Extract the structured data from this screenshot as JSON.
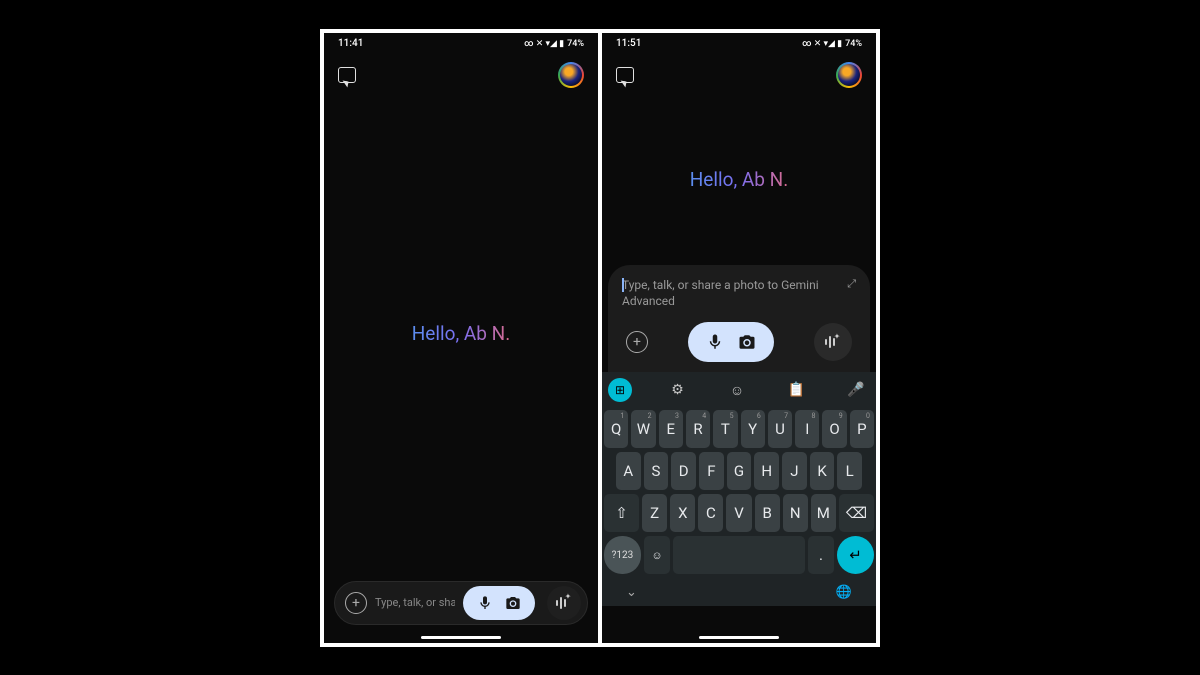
{
  "phone1": {
    "status": {
      "time": "11:41",
      "battery": "74%",
      "icons": "∞ ✕ ▾◢ ▮"
    },
    "top": {
      "chat_icon": "chat-icon",
      "avatar": "profile-avatar"
    },
    "greeting": "Hello, Ab N.",
    "input": {
      "plus": "+",
      "placeholder": "Type, talk, or share...",
      "mic": "mic-icon",
      "camera": "camera-icon",
      "live": "live-audio-icon"
    }
  },
  "phone2": {
    "status": {
      "time": "11:51",
      "battery": "74%",
      "icons": "∞ ✕ ▾◢ ▮"
    },
    "top": {
      "chat_icon": "chat-icon",
      "avatar": "profile-avatar"
    },
    "greeting": "Hello, Ab N.",
    "input": {
      "placeholder": "Type, talk, or share a photo to Gemini Advanced",
      "expand": "⤢",
      "plus": "+",
      "mic": "mic-icon",
      "camera": "camera-icon",
      "live": "live-audio-icon"
    },
    "keyboard": {
      "toolbar": {
        "grid": "⊞",
        "gear": "⚙",
        "emoji": "☺",
        "clipboard": "📋",
        "mic": "🎤"
      },
      "row1": [
        {
          "k": "Q",
          "h": "1"
        },
        {
          "k": "W",
          "h": "2"
        },
        {
          "k": "E",
          "h": "3"
        },
        {
          "k": "R",
          "h": "4"
        },
        {
          "k": "T",
          "h": "5"
        },
        {
          "k": "Y",
          "h": "6"
        },
        {
          "k": "U",
          "h": "7"
        },
        {
          "k": "I",
          "h": "8"
        },
        {
          "k": "O",
          "h": "9"
        },
        {
          "k": "P",
          "h": "0"
        }
      ],
      "row2": [
        "A",
        "S",
        "D",
        "F",
        "G",
        "H",
        "J",
        "K",
        "L"
      ],
      "row3": [
        "Z",
        "X",
        "C",
        "V",
        "B",
        "N",
        "M"
      ],
      "shift": "⇧",
      "backspace": "⌫",
      "sym": "?123",
      "emoji_key": "☺",
      "period": ".",
      "enter": "↵",
      "collapse": "⌄",
      "globe": "🌐"
    }
  }
}
